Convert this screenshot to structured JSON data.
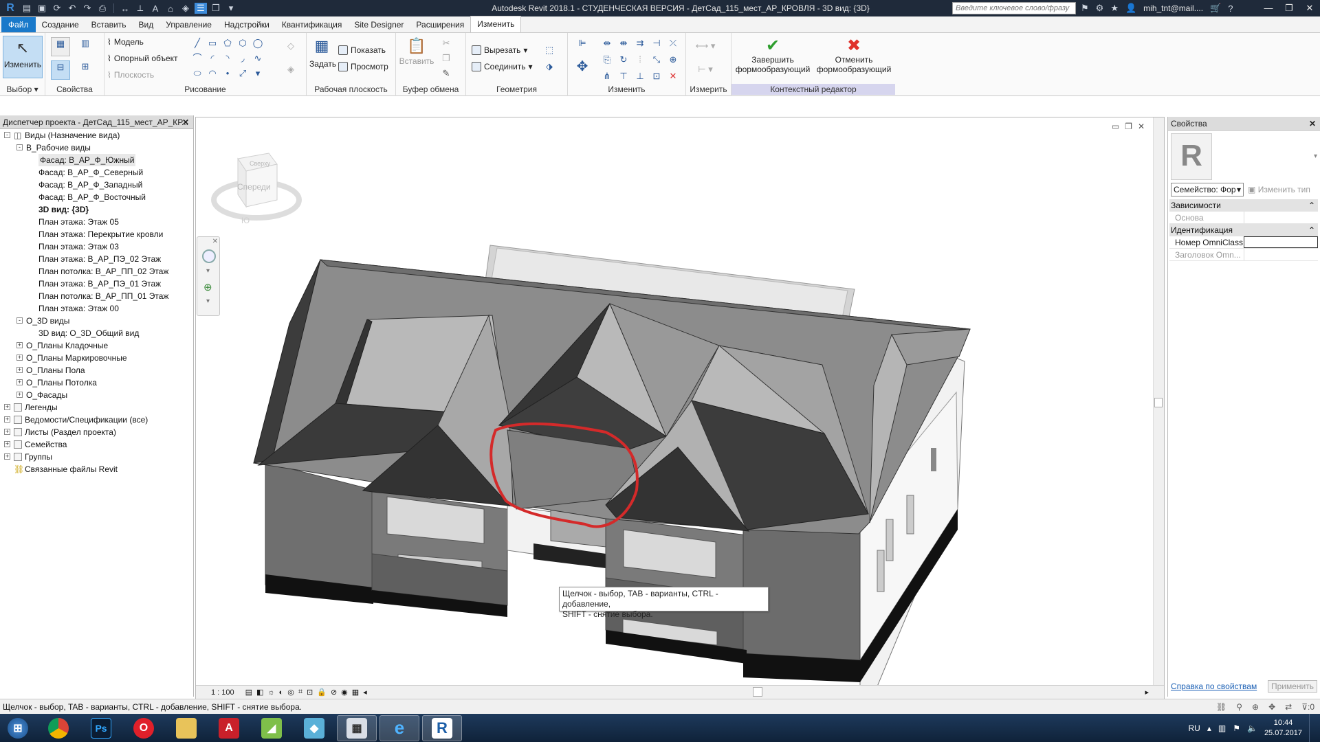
{
  "titlebar": {
    "title": "Autodesk Revit 2018.1 - СТУДЕНЧЕСКАЯ ВЕРСИЯ -    ДетСад_115_мест_АР_КРОВЛЯ - 3D вид: {3D}",
    "search_placeholder": "Введите ключевое слово/фразу",
    "user": "mih_tnt@mail....",
    "app_logo": "R"
  },
  "tabs": [
    "Файл",
    "Создание",
    "Вставить",
    "Вид",
    "Управление",
    "Надстройки",
    "Квантификация",
    "Site Designer",
    "Расширения",
    "Изменить"
  ],
  "ribbon": {
    "select": {
      "button": "Изменить",
      "label": "Выбор"
    },
    "properties": {
      "label": "Свойства"
    },
    "draw": {
      "model": "Модель",
      "ref": "Опорный объект",
      "plane": "Плоскость",
      "label": "Рисование"
    },
    "workplane": {
      "set": "Задать",
      "show": "Показать",
      "viewer": "Просмотр",
      "label": "Рабочая плоскость"
    },
    "clipboard": {
      "paste": "Вставить",
      "label": "Буфер обмена"
    },
    "geometry": {
      "cut": "Вырезать",
      "join": "Соединить",
      "label": "Геометрия"
    },
    "modify": {
      "label": "Изменить"
    },
    "measure": {
      "label": "Измерить"
    },
    "context": {
      "finish_1": "Завершить",
      "finish_2": "формообразующий",
      "cancel_1": "Отменить",
      "cancel_2": "формообразующий",
      "label": "Контекстный редактор"
    }
  },
  "browser": {
    "title": "Диспетчер проекта - ДетСад_115_мест_АР_КР...",
    "nodes": [
      {
        "label": "Виды (Назначение вида)",
        "level": 0,
        "exp": "-"
      },
      {
        "label": "В_Рабочие виды",
        "level": 1,
        "exp": "-"
      },
      {
        "label": "Фасад: В_АР_Ф_Южный",
        "level": 2,
        "selected": true
      },
      {
        "label": "Фасад: В_АР_Ф_Северный",
        "level": 2
      },
      {
        "label": "Фасад: В_АР_Ф_Западный",
        "level": 2
      },
      {
        "label": "Фасад: В_АР_Ф_Восточный",
        "level": 2
      },
      {
        "label": "3D вид: {3D}",
        "level": 2,
        "bold": true
      },
      {
        "label": "План этажа: Этаж 05",
        "level": 2
      },
      {
        "label": "План этажа: Перекрытие кровли",
        "level": 2
      },
      {
        "label": "План этажа: Этаж 03",
        "level": 2
      },
      {
        "label": "План этажа: В_АР_ПЭ_02 Этаж",
        "level": 2
      },
      {
        "label": "План потолка: В_АР_ПП_02 Этаж",
        "level": 2
      },
      {
        "label": "План этажа: В_АР_ПЭ_01 Этаж",
        "level": 2
      },
      {
        "label": "План потолка: В_АР_ПП_01 Этаж",
        "level": 2
      },
      {
        "label": "План этажа: Этаж 00",
        "level": 2
      },
      {
        "label": "О_3D виды",
        "level": 1,
        "exp": "-"
      },
      {
        "label": "3D вид: О_3D_Общий вид",
        "level": 2
      },
      {
        "label": "О_Планы Кладочные",
        "level": 1,
        "exp": "+"
      },
      {
        "label": "О_Планы Маркировочные",
        "level": 1,
        "exp": "+"
      },
      {
        "label": "О_Планы Пола",
        "level": 1,
        "exp": "+"
      },
      {
        "label": "О_Планы Потолка",
        "level": 1,
        "exp": "+"
      },
      {
        "label": "О_Фасады",
        "level": 1,
        "exp": "+"
      },
      {
        "label": "Легенды",
        "level": 0,
        "exp": "+",
        "icon": true
      },
      {
        "label": "Ведомости/Спецификации (все)",
        "level": 0,
        "exp": "+",
        "icon": true
      },
      {
        "label": "Листы (Раздел проекта)",
        "level": 0,
        "exp": "+",
        "icon": true
      },
      {
        "label": "Семейства",
        "level": 0,
        "exp": "+",
        "icon": true
      },
      {
        "label": "Группы",
        "level": 0,
        "exp": "+",
        "icon": true
      },
      {
        "label": "Связанные файлы Revit",
        "level": 0,
        "link": true
      }
    ]
  },
  "viewcube": {
    "top": "Сверху",
    "front": "Спереди",
    "compass": "Ю"
  },
  "viewport": {
    "scale": "1 : 100",
    "tooltip_1": "Щелчок - выбор, TAB - варианты, CTRL - добавление,",
    "tooltip_2": "SHIFT - снятие выбора."
  },
  "properties": {
    "title": "Свойства",
    "family": "Семейство: Фор",
    "edit_type": "Изменить тип",
    "sections": [
      "Зависимости",
      "Идентификация"
    ],
    "rows": {
      "base": "Основа",
      "omniclass": "Номер OmniClass",
      "omni_title": "Заголовок Omn..."
    },
    "help_link": "Справка по свойствам",
    "apply": "Применить"
  },
  "statusbar": {
    "text": "Щелчок - выбор, TAB - варианты, CTRL - добавление, SHIFT - снятие выбора.",
    "filter_count": ":0"
  },
  "taskbar": {
    "lang": "RU",
    "time": "10:44",
    "date": "25.07.2017"
  }
}
